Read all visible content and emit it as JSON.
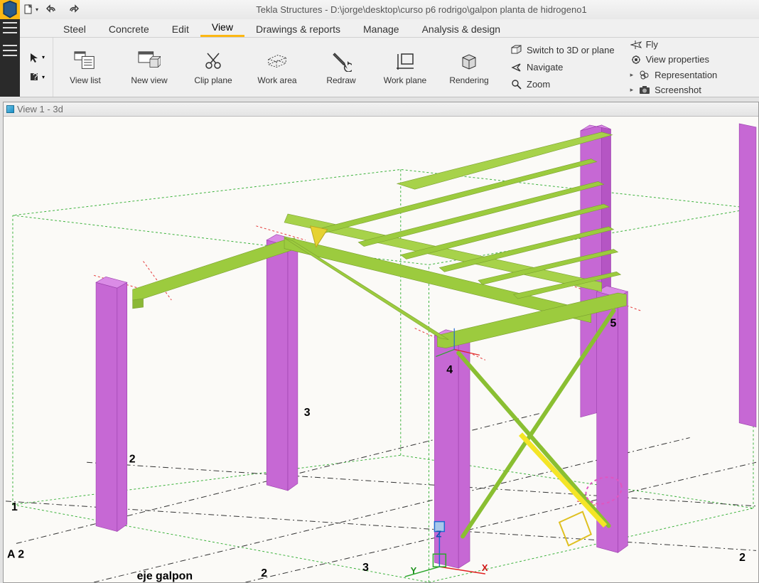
{
  "app_title": "Tekla Structures - D:\\jorge\\desktop\\curso p6 rodrigo\\galpon planta de hidrogeno1",
  "tabs": [
    "Steel",
    "Concrete",
    "Edit",
    "View",
    "Drawings & reports",
    "Manage",
    "Analysis & design"
  ],
  "active_tab": "View",
  "ribbon": {
    "big": [
      {
        "id": "view-list",
        "label": "View list"
      },
      {
        "id": "new-view",
        "label": "New view"
      },
      {
        "id": "clip-plane",
        "label": "Clip plane"
      },
      {
        "id": "work-area",
        "label": "Work area"
      },
      {
        "id": "redraw",
        "label": "Redraw"
      },
      {
        "id": "work-plane",
        "label": "Work plane"
      },
      {
        "id": "rendering",
        "label": "Rendering"
      }
    ],
    "col1": [
      {
        "id": "switch-3d",
        "label": "Switch to 3D or plane"
      },
      {
        "id": "navigate",
        "label": "Navigate"
      },
      {
        "id": "zoom",
        "label": "Zoom"
      }
    ],
    "col2": [
      {
        "id": "fly",
        "label": "Fly"
      },
      {
        "id": "view-properties",
        "label": "View properties"
      },
      {
        "id": "representation",
        "label": "Representation"
      },
      {
        "id": "screenshot",
        "label": "Screenshot"
      }
    ]
  },
  "view": {
    "title": "View 1 - 3d",
    "axis_labels": {
      "x": "X",
      "y": "Y",
      "z": "Z"
    },
    "grid_numbers": [
      "1",
      "2",
      "3",
      "4",
      "5"
    ],
    "grid_letters": [
      "A 2"
    ],
    "grid_name": "eje galpon",
    "right_label_2": "2"
  }
}
